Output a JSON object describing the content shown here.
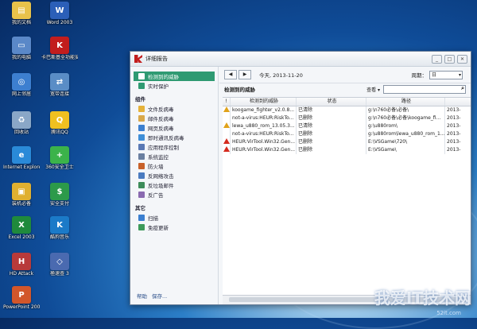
{
  "desktop": {
    "icons": [
      {
        "label": "我的文档",
        "color": "#e8c24a",
        "glyph": "▤"
      },
      {
        "label": "Word 2003",
        "color": "#2b5fb8",
        "glyph": "W"
      },
      {
        "label": "我的电脑",
        "color": "#5a88c8",
        "glyph": "▭"
      },
      {
        "label": "卡巴斯基全功能安全软件 2013",
        "color": "#c21d1d",
        "glyph": "K"
      },
      {
        "label": "网上邻居",
        "color": "#3d7fd0",
        "glyph": "◎"
      },
      {
        "label": "宽带连接",
        "color": "#5a8dc6",
        "glyph": "⇄"
      },
      {
        "label": "回收站",
        "color": "#8aa7c7",
        "glyph": "♻"
      },
      {
        "label": "腾讯QQ",
        "color": "#f0c020",
        "glyph": "Q"
      },
      {
        "label": "Internet Explorer",
        "color": "#2a8ad8",
        "glyph": "e"
      },
      {
        "label": "360安全卫士",
        "color": "#3bb34a",
        "glyph": "+"
      },
      {
        "label": "装机必备",
        "color": "#e0b030",
        "glyph": "▣"
      },
      {
        "label": "安全支付",
        "color": "#2c9a4a",
        "glyph": "$"
      },
      {
        "label": "Excel 2003",
        "color": "#1f8a3c",
        "glyph": "X"
      },
      {
        "label": "酷狗音乐",
        "color": "#1b7ac8",
        "glyph": "K"
      },
      {
        "label": "HD Attack",
        "color": "#b83a3a",
        "glyph": "H"
      },
      {
        "label": "極速查 3",
        "color": "#4a6ab0",
        "glyph": "◇"
      },
      {
        "label": "PowerPoint 2003",
        "color": "#d2562a",
        "glyph": "P"
      }
    ]
  },
  "window": {
    "title": "详细报告",
    "sidebar": {
      "top_items": [
        {
          "label": "检测到的威胁",
          "color": "#2f9a72"
        },
        {
          "label": "实时保护",
          "color": "#2f9a72"
        }
      ],
      "group1": "组件",
      "components": [
        {
          "label": "文件反病毒",
          "color": "#e5b23a"
        },
        {
          "label": "邮件反病毒",
          "color": "#d9a84a"
        },
        {
          "label": "网页反病毒",
          "color": "#3b7fd0"
        },
        {
          "label": "即时通讯反病毒",
          "color": "#3f8fd8"
        },
        {
          "label": "应用程序控制",
          "color": "#5a79b5"
        },
        {
          "label": "系统监控",
          "color": "#6a7fa0"
        },
        {
          "label": "防火墙",
          "color": "#c8612a"
        },
        {
          "label": "反网络攻击",
          "color": "#4a7bc0"
        },
        {
          "label": "反垃圾邮件",
          "color": "#3d8c5a"
        },
        {
          "label": "反广告",
          "color": "#8a6ab0"
        }
      ],
      "group2": "其它",
      "others": [
        {
          "label": "扫描",
          "color": "#3b7fd0"
        },
        {
          "label": "免疫更新",
          "color": "#3d9a5a"
        }
      ],
      "help": "帮助",
      "save": "保存..."
    },
    "nav": {
      "back": "◀",
      "forward": "▶",
      "date": "今天, 2013-11-20",
      "period_label": "周期：",
      "period_value": "日"
    },
    "section_title": "检测到的威胁",
    "view_label": "查看",
    "table": {
      "headers": [
        "!",
        "检测到的威胁",
        "状态",
        "路径",
        ""
      ],
      "rows": [
        {
          "level": "warn",
          "threat": "koogame_fighter_v2.0.8...",
          "status": "已清除",
          "path": "g:\\n760必备\\必备\\",
          "time": "2013-"
        },
        {
          "level": "none",
          "threat": "not-a-virus:HEUR:RiskTo...",
          "status": "已删除",
          "path": "g:\\n760必备\\必备\\koogame_fi...",
          "time": "2013-"
        },
        {
          "level": "warn",
          "threat": "lewa_u880_rom_13.05.3...",
          "status": "已清除",
          "path": "g:\\u880rom\\",
          "time": "2013-"
        },
        {
          "level": "none",
          "threat": "not-a-virus:HEUR:RiskTo...",
          "status": "已删除",
          "path": "g:\\u880rom\\lewa_u880_rom_1...",
          "time": "2013-"
        },
        {
          "level": "red",
          "threat": "HEUR:VirTool.Win32.Gen...",
          "status": "已删除",
          "path": "E:\\VSGame\\720\\",
          "time": "2013-"
        },
        {
          "level": "red",
          "threat": "HEUR:VirTool.Win32.Gen...",
          "status": "已删除",
          "path": "E:\\VSGame\\",
          "time": "2013-"
        }
      ]
    }
  },
  "watermark": {
    "main": "我爱IT技术网",
    "sub": "52it.com"
  }
}
